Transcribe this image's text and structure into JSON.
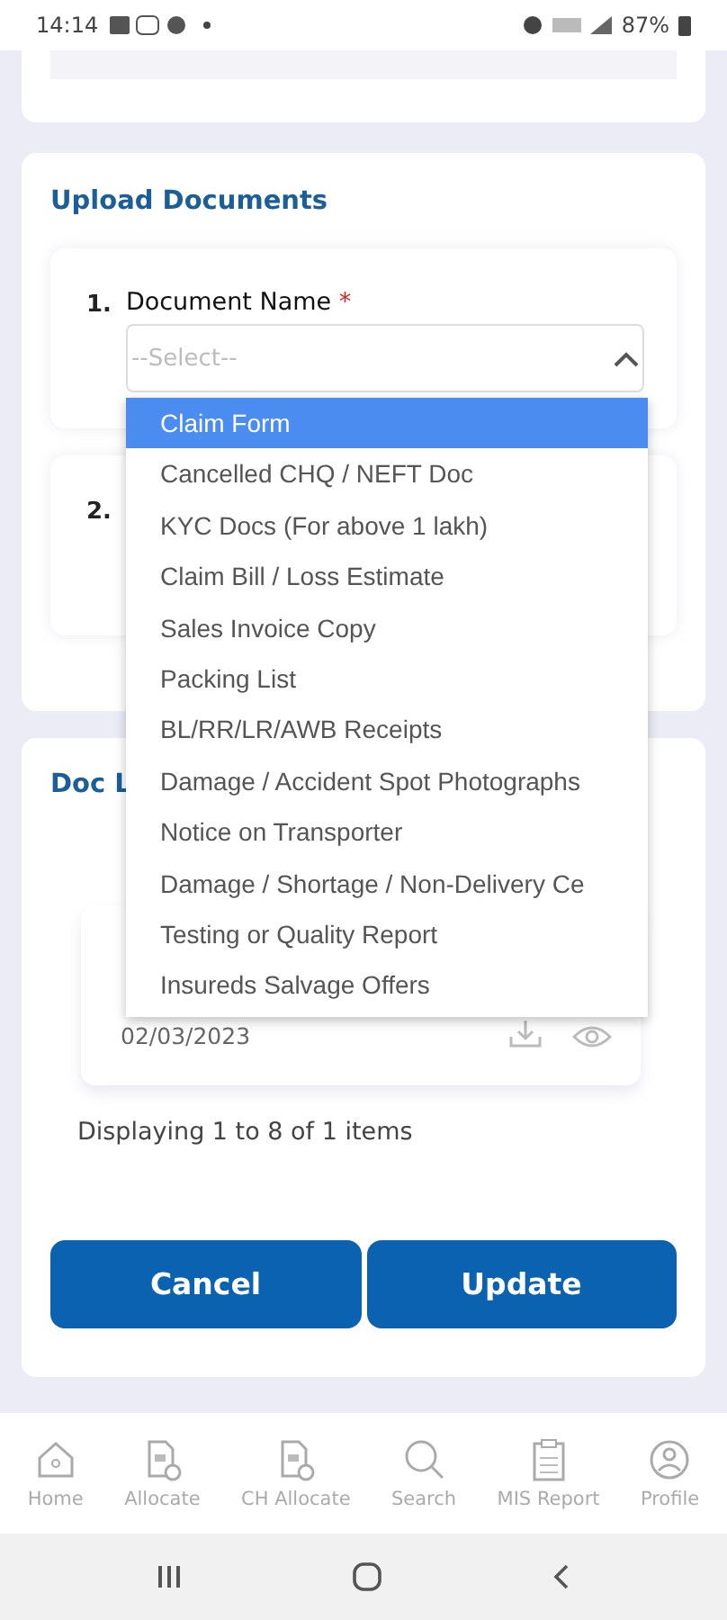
{
  "status_bar": {
    "time": "14:14",
    "battery": "87%"
  },
  "upload_documents": {
    "title": "Upload Documents",
    "items": [
      {
        "number": "1.",
        "label": "Document Name",
        "required_mark": "*",
        "select": {
          "placeholder": "--Select--",
          "expanded": true,
          "options": [
            {
              "label": "Claim Form",
              "selected": true
            },
            {
              "label": "Cancelled CHQ / NEFT Doc",
              "selected": false
            },
            {
              "label": "KYC Docs (For above 1 lakh)",
              "selected": false
            },
            {
              "label": "Claim Bill / Loss Estimate",
              "selected": false
            },
            {
              "label": "Sales Invoice Copy",
              "selected": false
            },
            {
              "label": "Packing List",
              "selected": false
            },
            {
              "label": "BL/RR/LR/AWB Receipts",
              "selected": false
            },
            {
              "label": "Damage / Accident Spot Photographs",
              "selected": false
            },
            {
              "label": "Notice on Transporter",
              "selected": false
            },
            {
              "label": "Damage / Shortage / Non-Delivery Ce",
              "selected": false
            },
            {
              "label": "Testing or Quality Report",
              "selected": false
            },
            {
              "label": "Insureds Salvage Offers",
              "selected": false
            }
          ]
        }
      },
      {
        "number": "2."
      }
    ]
  },
  "doc_list": {
    "title": "Doc L",
    "docs": [
      {
        "date": "02/03/2023"
      }
    ],
    "pagination": "Displaying 1 to 8 of 1 items"
  },
  "buttons": [
    "Cancel",
    "Update"
  ],
  "bottom_nav": [
    {
      "label": "Home",
      "kind": "home"
    },
    {
      "label": "Allocate",
      "kind": "doc"
    },
    {
      "label": "CH Allocate",
      "kind": "doc"
    },
    {
      "label": "Search",
      "kind": "search"
    },
    {
      "label": "MIS Report",
      "kind": "report"
    },
    {
      "label": "Profile",
      "kind": "profile"
    }
  ]
}
